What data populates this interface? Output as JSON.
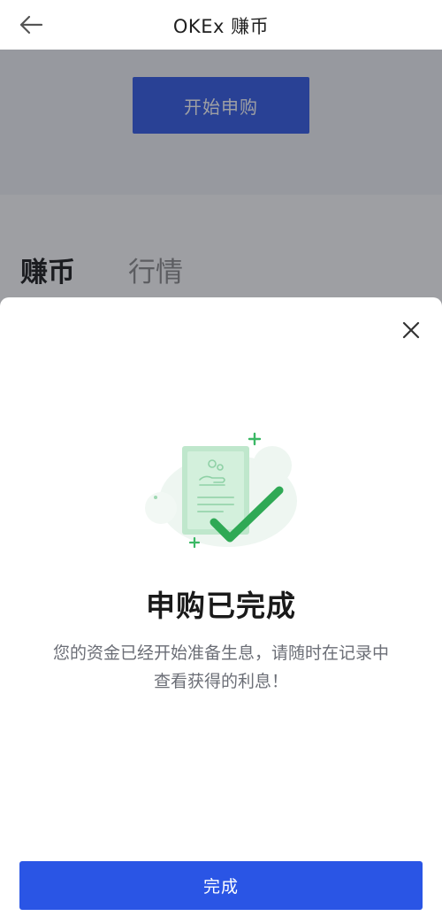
{
  "header": {
    "title": "OKEx 赚币",
    "back_icon": "arrow-left-icon"
  },
  "background": {
    "subscribe_button_label": "开始申购",
    "tabs": [
      {
        "label": "赚币",
        "active": true
      },
      {
        "label": "行情",
        "active": false
      }
    ]
  },
  "dialog": {
    "close_icon": "close-icon",
    "illustration": "document-check-icon",
    "title": "申购已完成",
    "description": "您的资金已经开始准备生息，请随时在记录中查看获得的利息！",
    "done_button_label": "完成"
  },
  "colors": {
    "primary": "#2a55e5",
    "success": "#3bb865",
    "overlay": "#282a34"
  }
}
